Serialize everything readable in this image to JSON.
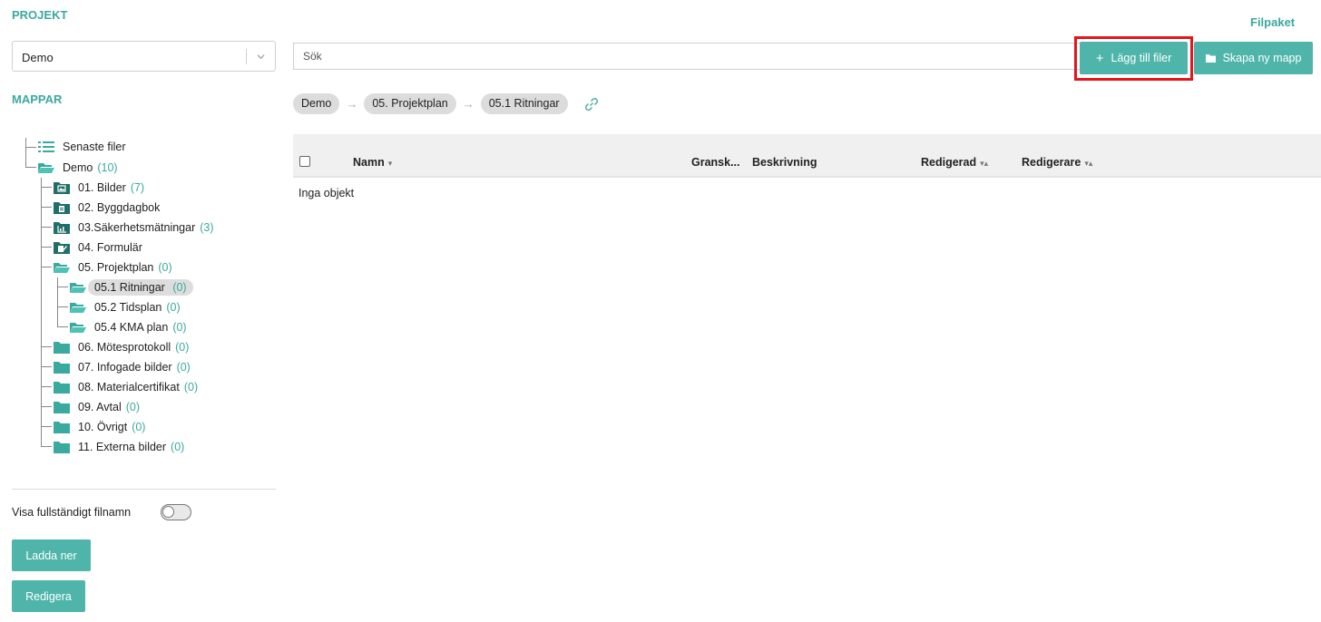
{
  "sidebar": {
    "project_heading": "PROJEKT",
    "project_select": "Demo",
    "folders_heading": "MAPPAR",
    "tree": {
      "recent": "Senaste filer",
      "root": {
        "label": "Demo",
        "count": "(10)"
      },
      "items": [
        {
          "label": "01. Bilder",
          "count": "(7)",
          "icon": "image-folder-icon"
        },
        {
          "label": "02. Byggdagbok",
          "count": "",
          "icon": "diary-folder-icon"
        },
        {
          "label": "03.Säkerhetsmätningar",
          "count": "(3)",
          "icon": "chart-folder-icon"
        },
        {
          "label": "04. Formulär",
          "count": "",
          "icon": "form-folder-icon"
        },
        {
          "label": "05. Projektplan",
          "count": "(0)",
          "icon": "folder-open-icon"
        },
        {
          "label": "06. Mötesprotokoll",
          "count": "(0)",
          "icon": "folder-icon"
        },
        {
          "label": "07. Infogade bilder",
          "count": "(0)",
          "icon": "folder-icon"
        },
        {
          "label": "08. Materialcertifikat",
          "count": "(0)",
          "icon": "folder-icon"
        },
        {
          "label": "09. Avtal",
          "count": "(0)",
          "icon": "folder-icon"
        },
        {
          "label": "10. Övrigt",
          "count": "(0)",
          "icon": "folder-icon"
        },
        {
          "label": "11. Externa bilder",
          "count": "(0)",
          "icon": "folder-icon"
        }
      ],
      "subitems": [
        {
          "label": "05.1 Ritningar",
          "count": "(0)",
          "selected": true
        },
        {
          "label": "05.2 Tidsplan",
          "count": "(0)"
        },
        {
          "label": "05.4 KMA plan",
          "count": "(0)"
        }
      ]
    },
    "full_filename_label": "Visa fullständigt filnamn",
    "full_filename_on": false,
    "download_button": "Ladda ner",
    "edit_button": "Redigera"
  },
  "header": {
    "filpaket": "Filpaket",
    "search_placeholder": "Sök",
    "add_files_button": "Lägg till filer",
    "new_folder_button": "Skapa ny mapp"
  },
  "breadcrumb": [
    "Demo",
    "05. Projektplan",
    "05.1 Ritningar"
  ],
  "table": {
    "columns": {
      "name": "Namn",
      "review": "Gransk...",
      "description": "Beskrivning",
      "edited": "Redigerad",
      "editor": "Redigerare"
    },
    "empty_text": "Inga objekt"
  },
  "colors": {
    "accent": "#4fb5ab",
    "accent_text": "#3aa99f",
    "highlight": "#e6141b"
  }
}
